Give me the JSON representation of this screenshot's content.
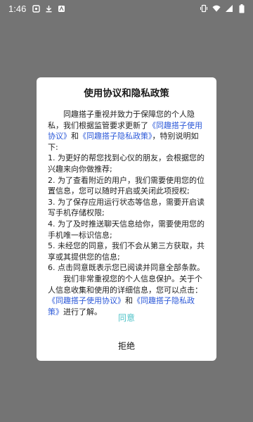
{
  "status_bar": {
    "time": "1:46",
    "left_icons": [
      "notification-icon",
      "download-icon",
      "app-icon"
    ],
    "right_icons": [
      "vibrate-icon",
      "wifi-icon",
      "signal-icon",
      "battery-icon"
    ]
  },
  "dialog": {
    "title": "使用协议和隐私政策",
    "intro_1": "同趣搭子重视并致力于保障您的个人隐私，我们根据监管要求更新了",
    "intro_link_1": "《同趣搭子使用协议》",
    "intro_2": "和",
    "intro_link_2": "《同趣搭子隐私政策》",
    "intro_3": "，特别说明如下:",
    "items": [
      "1. 为更好的帮您找到心仪的朋友，会根据您的兴趣来向你做推荐;",
      "2. 为了查看附近的用户，我们需要使用您的位置信息，您可以随时开启或关闭此项授权;",
      "3. 为了保存应用运行状态等信息，需要开启读写手机存储权限;",
      "4. 为了及时推送聊天信息给你，需要使用您的手机唯一标识信息;",
      "5. 未经您的同意，我们不会从第三方获取，共享或其提供您的信息;",
      "6. 点击同意既表示您已阅读并同意全部条款。"
    ],
    "outro_1": "我们非常重视您的个人信息保护。关于个人信息收集和使用的详细信息，您可以点击：",
    "outro_link_1": "《同趣搭子使用协议》",
    "outro_2": "和",
    "outro_link_2": "《同趣搭子隐私政策》",
    "outro_3": "进行了解。",
    "agree_label": "同意",
    "refuse_label": "拒绝"
  },
  "colors": {
    "scrim": "#747474",
    "link": "#2b58d8",
    "agree": "#4fc3c8"
  }
}
